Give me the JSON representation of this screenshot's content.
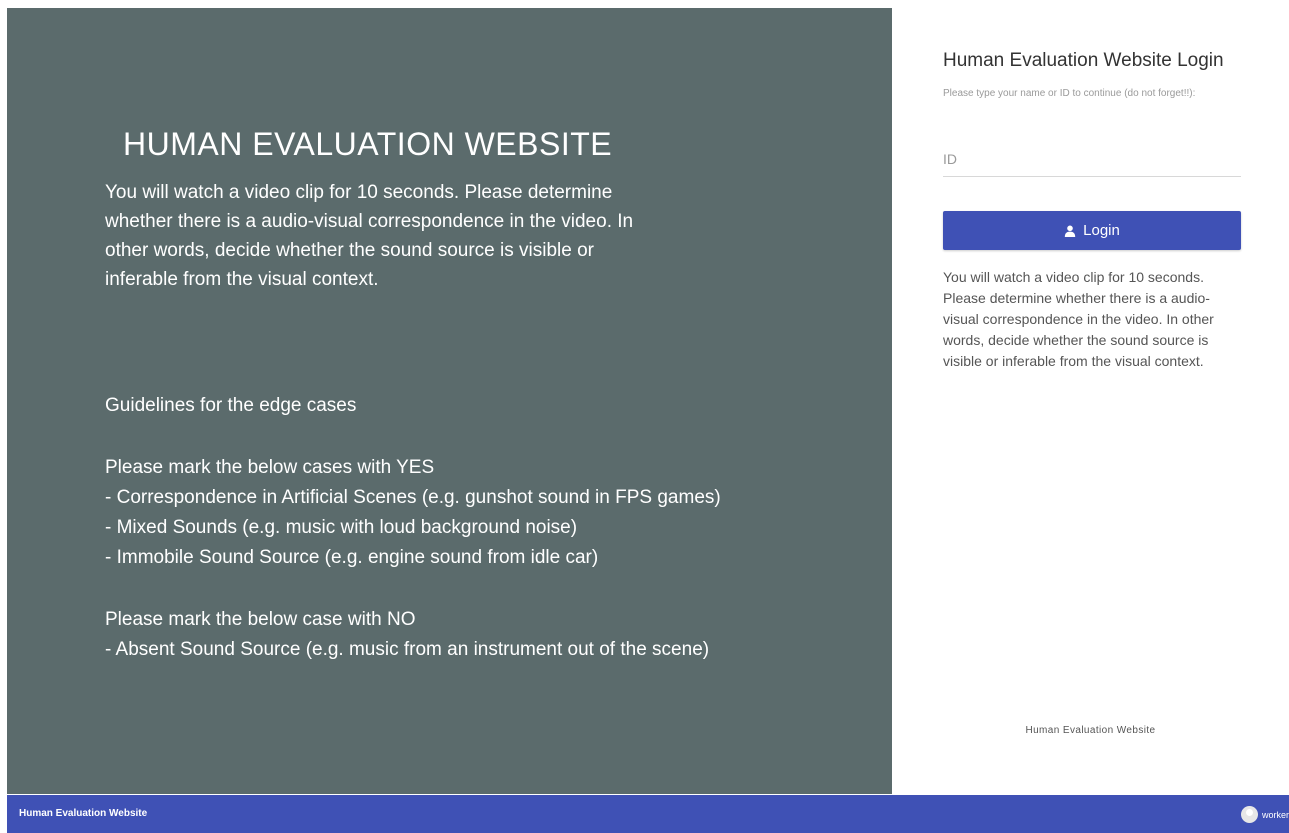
{
  "left": {
    "title": "HUMAN EVALUATION WEBSITE",
    "intro": "You will watch a video clip for 10 seconds. Please determine whether there is a audio-visual correspondence in the video. In other words, decide whether the sound source is visible or inferable from the visual context.",
    "guidelines_heading": "Guidelines for the edge cases",
    "yes_heading": "Please mark the below cases with YES",
    "yes_items": [
      "- Correspondence in Artificial Scenes (e.g. gunshot sound in FPS games)",
      "- Mixed Sounds (e.g. music with loud background noise)",
      "- Immobile Sound Source (e.g. engine sound from idle car)"
    ],
    "no_heading": "Please mark the below case with NO",
    "no_items": [
      "- Absent Sound Source (e.g. music from an instrument out of the scene)"
    ]
  },
  "login": {
    "title": "Human Evaluation Website Login",
    "subtitle": "Please type your name or ID to continue (do not forget!!):",
    "id_placeholder": "ID",
    "id_value": "",
    "button_label": "Login",
    "description": "You will watch a video clip for 10 seconds. Please determine whether there is a audio-visual correspondence in the video. In other words, decide whether the sound source is visible or inferable from the visual context.",
    "footer": "Human Evaluation Website"
  },
  "bottom_bar": {
    "title": "Human Evaluation Website",
    "user_label": "worker"
  },
  "colors": {
    "left_panel_bg": "#5b6b6c",
    "accent": "#3f51b5"
  },
  "icons": {
    "login_button_icon": "user-icon",
    "avatar": "avatar-icon"
  }
}
